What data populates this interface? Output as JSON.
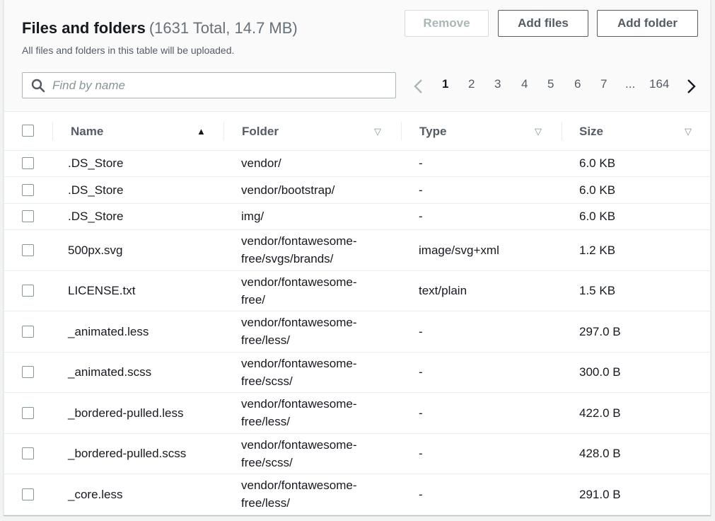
{
  "header": {
    "title": "Files and folders",
    "counter": "(1631 Total, 14.7 MB)",
    "description": "All files and folders in this table will be uploaded.",
    "buttons": {
      "remove": "Remove",
      "add_files": "Add files",
      "add_folder": "Add folder"
    }
  },
  "search": {
    "placeholder": "Find by name",
    "value": "",
    "icon": "search-icon"
  },
  "pagination": {
    "pages": [
      "1",
      "2",
      "3",
      "4",
      "5",
      "6",
      "7",
      "...",
      "164"
    ],
    "current": "1"
  },
  "table": {
    "columns": [
      "Name",
      "Folder",
      "Type",
      "Size"
    ],
    "sort_column": "Name",
    "sort_direction": "ascending",
    "rows": [
      {
        "name": ".DS_Store",
        "folder": [
          "vendor/"
        ],
        "type": "-",
        "size": "6.0 KB"
      },
      {
        "name": ".DS_Store",
        "folder": [
          "vendor/bootstrap/"
        ],
        "type": "-",
        "size": "6.0 KB"
      },
      {
        "name": ".DS_Store",
        "folder": [
          "img/"
        ],
        "type": "-",
        "size": "6.0 KB"
      },
      {
        "name": "500px.svg",
        "folder": [
          "vendor/fontawesome-",
          "free/svgs/brands/"
        ],
        "type": "image/svg+xml",
        "size": "1.2 KB"
      },
      {
        "name": "LICENSE.txt",
        "folder": [
          "vendor/fontawesome-",
          "free/"
        ],
        "type": "text/plain",
        "size": "1.5 KB"
      },
      {
        "name": "_animated.less",
        "folder": [
          "vendor/fontawesome-",
          "free/less/"
        ],
        "type": "-",
        "size": "297.0 B"
      },
      {
        "name": "_animated.scss",
        "folder": [
          "vendor/fontawesome-",
          "free/scss/"
        ],
        "type": "-",
        "size": "300.0 B"
      },
      {
        "name": "_bordered-pulled.less",
        "folder": [
          "vendor/fontawesome-",
          "free/less/"
        ],
        "type": "-",
        "size": "422.0 B"
      },
      {
        "name": "_bordered-pulled.scss",
        "folder": [
          "vendor/fontawesome-",
          "free/scss/"
        ],
        "type": "-",
        "size": "428.0 B"
      },
      {
        "name": "_core.less",
        "folder": [
          "vendor/fontawesome-",
          "free/less/"
        ],
        "type": "-",
        "size": "291.0 B"
      }
    ]
  }
}
